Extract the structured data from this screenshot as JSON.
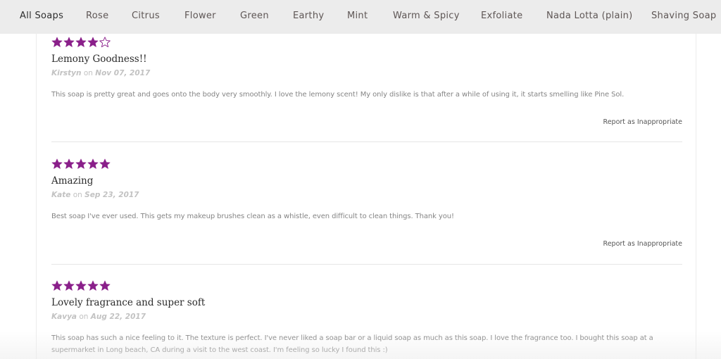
{
  "nav": {
    "items": [
      {
        "label": "All Soaps",
        "active": true
      },
      {
        "label": "Rose"
      },
      {
        "label": "Citrus"
      },
      {
        "label": "Flower"
      },
      {
        "label": "Green"
      },
      {
        "label": "Earthy"
      },
      {
        "label": "Mint"
      },
      {
        "label": "Warm & Spicy"
      },
      {
        "label": "Exfoliate"
      },
      {
        "label": "Nada Lotta (plain)"
      },
      {
        "label": "Shaving Soap"
      }
    ]
  },
  "colors": {
    "star_fill": "#8a1f8a",
    "nav_bg": "#ececec"
  },
  "reviews": [
    {
      "rating": 4,
      "max_rating": 5,
      "title": "Lemony Goodness!!",
      "author": "Kirstyn",
      "on": "on",
      "date": "Nov 07, 2017",
      "body": "This soap is pretty great and goes onto the body very smoothly. I love the lemony scent! My only dislike is that after a while of using it, it starts smelling like Pine Sol.",
      "report_label": "Report as Inappropriate"
    },
    {
      "rating": 5,
      "max_rating": 5,
      "title": "Amazing",
      "author": "Kate",
      "on": "on",
      "date": "Sep 23, 2017",
      "body": "Best soap I've ever used. This gets my makeup brushes clean as a whistle, even difficult to clean things. Thank you!",
      "report_label": "Report as Inappropriate"
    },
    {
      "rating": 5,
      "max_rating": 5,
      "title": "Lovely fragrance and super soft",
      "author": "Kavya",
      "on": "on",
      "date": "Aug 22, 2017",
      "body": "This soap has such a nice feeling to it. The texture is perfect. I've never liked a soap bar or a liquid soap as much as this soap. I love the fragrance too. I bought this soap at a supermarket in Long beach, CA during a visit to the west coast. I'm feeling so lucky I found this :)"
    }
  ]
}
